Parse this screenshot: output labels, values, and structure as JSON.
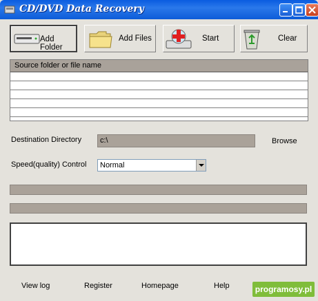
{
  "window": {
    "title": "CD/DVD Data Recovery"
  },
  "toolbar": {
    "add_folder": "Add Folder",
    "add_files": "Add Files",
    "start": "Start",
    "clear": "Clear"
  },
  "source_list": {
    "header": "Source folder or file name",
    "rows": [
      "",
      "",
      "",
      "",
      ""
    ]
  },
  "destination": {
    "label": "Destination Directory",
    "value": "c:\\",
    "browse": "Browse"
  },
  "speed": {
    "label": "Speed(quality) Control",
    "selected": "Normal"
  },
  "footer": {
    "view_log": "View log",
    "register": "Register",
    "homepage": "Homepage",
    "help": "Help"
  },
  "watermark": "programosy.pl"
}
